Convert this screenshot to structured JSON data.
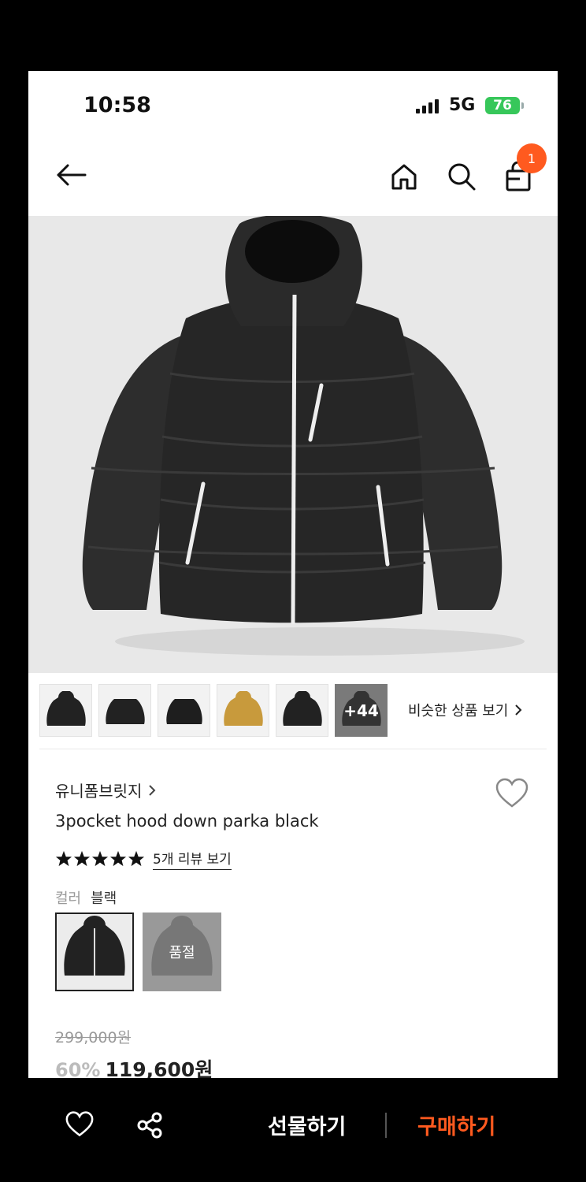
{
  "status_bar": {
    "time": "10:58",
    "network": "5G",
    "battery": "76"
  },
  "nav": {
    "cart_count": "1"
  },
  "thumbnails": {
    "more_label": "+44"
  },
  "similar_label": "비슷한 상품 보기",
  "product": {
    "brand": "유니폼브릿지",
    "name": "3pocket hood down parka black",
    "rating_stars": 5,
    "review_link": "5개 리뷰 보기",
    "color_label": "컬러",
    "color_value": "블랙",
    "sold_out_label": "품절",
    "original_price": "299,000원",
    "discount": "60%",
    "price": "119,600원"
  },
  "bottom_bar": {
    "gift_label": "선물하기",
    "buy_label": "구매하기"
  },
  "colors": {
    "accent": "#ff5a1f",
    "battery": "#37c75a",
    "jacket": "#2a2a2a"
  }
}
